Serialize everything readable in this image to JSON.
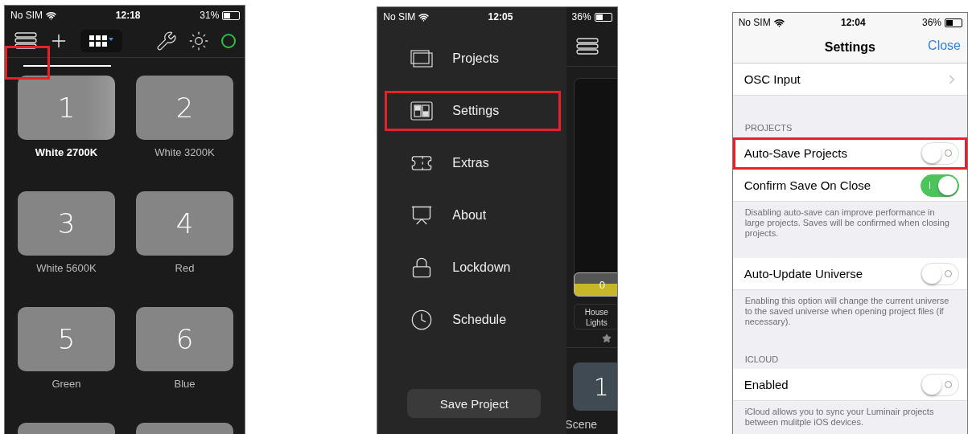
{
  "scene_screen": {
    "status_bar": {
      "carrier": "No SIM",
      "time": "12:18",
      "battery": "31%"
    },
    "highlight_marker": true,
    "tab_underline": true,
    "scenes": [
      {
        "number": "1",
        "label": "White 2700K",
        "selected": true
      },
      {
        "number": "2",
        "label": "White 3200K",
        "selected": false
      },
      {
        "number": "3",
        "label": "White 5600K",
        "selected": false
      },
      {
        "number": "4",
        "label": "Red",
        "selected": false
      },
      {
        "number": "5",
        "label": "Green",
        "selected": false
      },
      {
        "number": "6",
        "label": "Blue",
        "selected": false
      },
      {
        "selected": false
      },
      {
        "selected": false
      }
    ]
  },
  "menu_screen": {
    "status_bar": {
      "carrier": "No SIM",
      "time": "12:05",
      "battery": "36%"
    },
    "items": [
      {
        "kind": "projects",
        "label": "Projects",
        "highlighted": false
      },
      {
        "kind": "settings",
        "label": "Settings",
        "highlighted": true
      },
      {
        "kind": "extras",
        "label": "Extras",
        "highlighted": false
      },
      {
        "kind": "about",
        "label": "About",
        "highlighted": false
      },
      {
        "kind": "lockdown",
        "label": "Lockdown",
        "highlighted": false
      },
      {
        "kind": "schedule",
        "label": "Schedule",
        "highlighted": false
      }
    ],
    "save_button": "Save Project",
    "behind": {
      "fader_value": "0",
      "fader_label": "House Lights",
      "favorite": true,
      "scene_number": "1",
      "scene_label": "Scene"
    }
  },
  "settings_screen": {
    "status_bar": {
      "carrier": "No SIM",
      "time": "12:04",
      "battery": "36%"
    },
    "title": "Settings",
    "close": "Close",
    "sections": [
      {
        "rows": [
          {
            "kind": "link",
            "label": "OSC Input",
            "highlighted": false
          }
        ]
      },
      {
        "header": "PROJECTS",
        "rows": [
          {
            "kind": "toggle",
            "label": "Auto-Save Projects",
            "on": false,
            "highlighted": true
          },
          {
            "kind": "toggle",
            "label": "Confirm Save On Close",
            "on": true,
            "highlighted": false
          }
        ],
        "footer": "Disabling auto-save can improve performance in large projects. Saves will be confirmed when closing projects."
      },
      {
        "rows": [
          {
            "kind": "toggle",
            "label": "Auto-Update Universe",
            "on": false,
            "highlighted": false
          }
        ],
        "footer": "Enabling this option will change the current universe to the saved universe when opening project files (if necessary)."
      },
      {
        "header": "ICLOUD",
        "rows": [
          {
            "kind": "toggle",
            "label": "Enabled",
            "on": false,
            "highlighted": false
          }
        ],
        "footer": "iCloud allows you to sync your Luminair projects between mulitple iOS devices."
      }
    ]
  }
}
